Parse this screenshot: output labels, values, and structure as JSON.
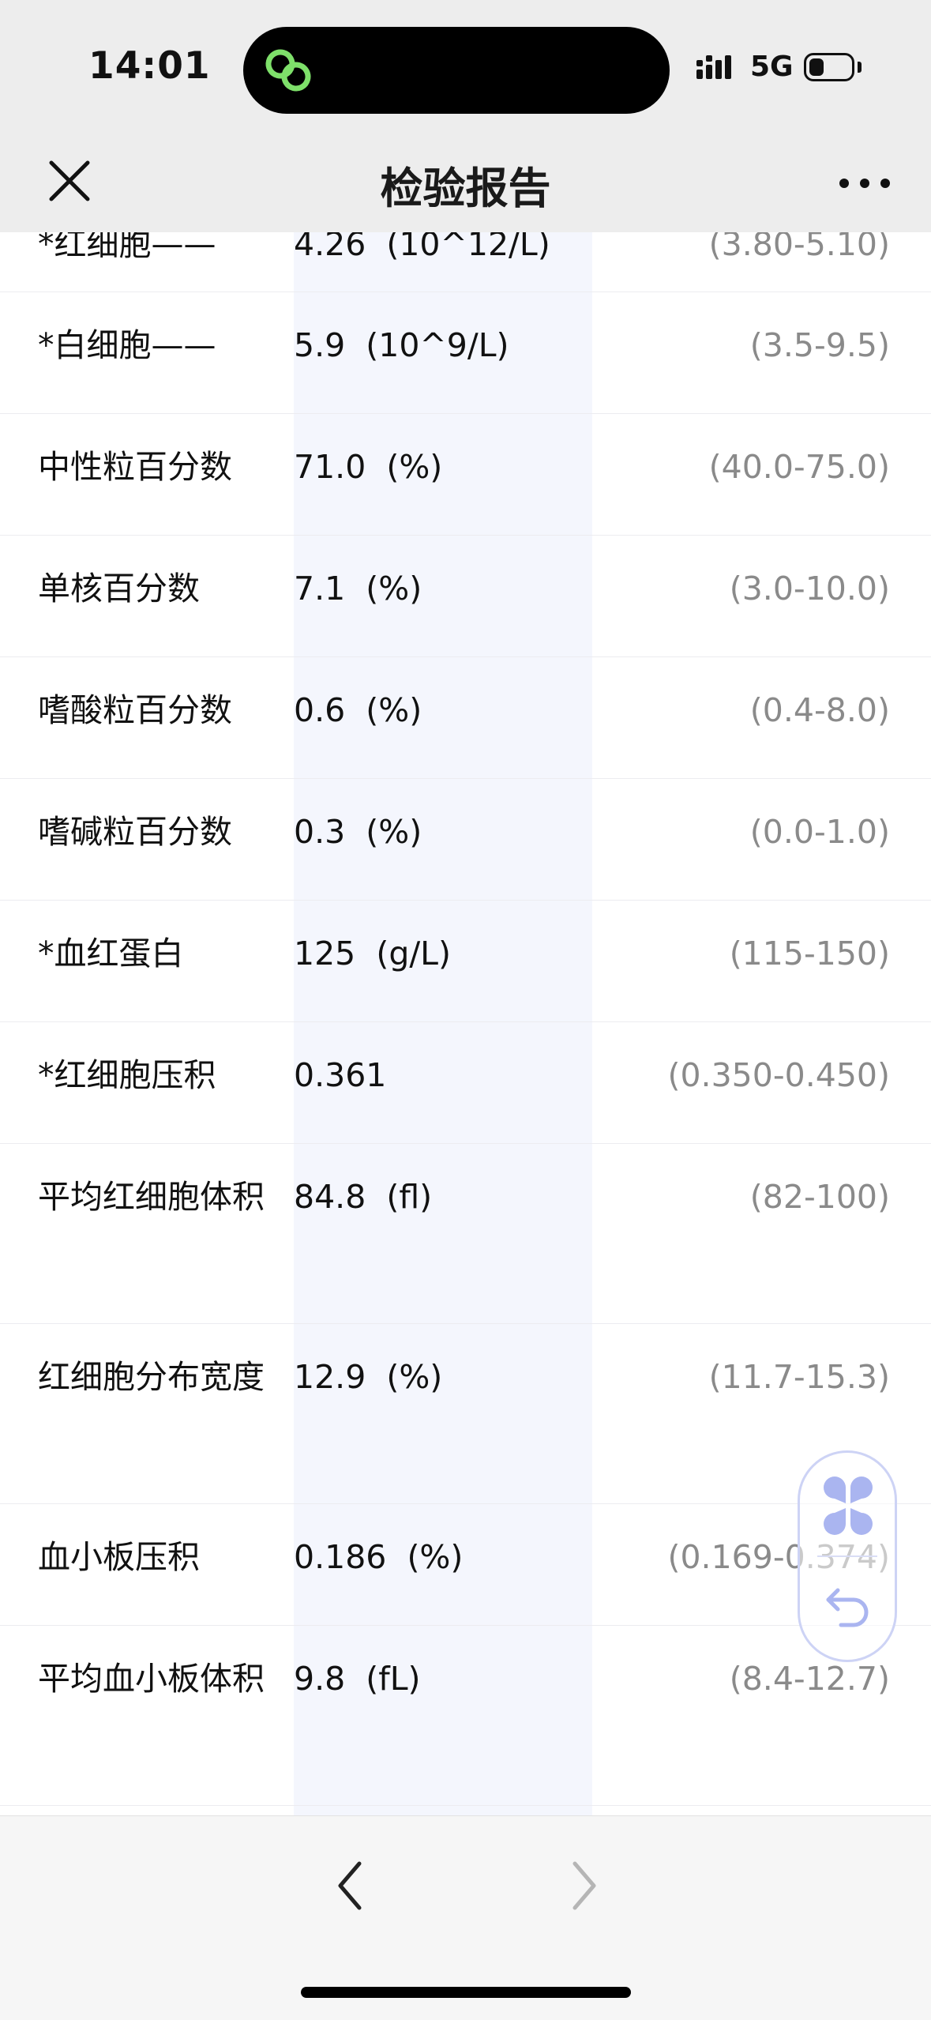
{
  "status_bar": {
    "time": "14:01",
    "network": "5G",
    "battery_level": 0.35,
    "island_icon": "link-app-icon",
    "island_icon_color": "#7ee06a"
  },
  "nav": {
    "title": "检验报告",
    "close_icon": "close-icon",
    "more_icon": "more-dots-icon"
  },
  "report": {
    "rows": [
      {
        "name": "*红细胞——",
        "value": "4.26  (10^12/L)",
        "range": "(3.80-5.10)"
      },
      {
        "name": "*白细胞——",
        "value": "5.9  (10^9/L)",
        "range": "(3.5-9.5)"
      },
      {
        "name": "中性粒百分数",
        "value": "71.0  (%)",
        "range": "(40.0-75.0)"
      },
      {
        "name": "单核百分数",
        "value": "7.1  (%)",
        "range": "(3.0-10.0)"
      },
      {
        "name": "嗜酸粒百分数",
        "value": "0.6  (%)",
        "range": "(0.4-8.0)"
      },
      {
        "name": "嗜碱粒百分数",
        "value": "0.3  (%)",
        "range": "(0.0-1.0)"
      },
      {
        "name": "*血红蛋白",
        "value": "125  (g/L)",
        "range": "(115-150)"
      },
      {
        "name": "*红细胞压积",
        "value": "0.361",
        "range": "(0.350-0.450)"
      },
      {
        "name": "平均红细胞体积",
        "value": "84.8  (fl)",
        "range": "(82-100)"
      },
      {
        "name": "红细胞分布宽度",
        "value": "12.9  (%)",
        "range": "(11.7-15.3)"
      },
      {
        "name": "血小板压积",
        "value": "0.186  (%)",
        "range": "(0.169-0.374)"
      },
      {
        "name": "平均血小板体积",
        "value": "9.8  (fL)",
        "range": "(8.4-12.7)"
      }
    ]
  },
  "floating_widget": {
    "top_icon": "grid-clover-icon",
    "bottom_icon": "undo-arrow-icon",
    "accent": "#aab5f0"
  },
  "toolbar": {
    "back_icon": "chevron-left-icon",
    "forward_icon": "chevron-right-icon"
  }
}
